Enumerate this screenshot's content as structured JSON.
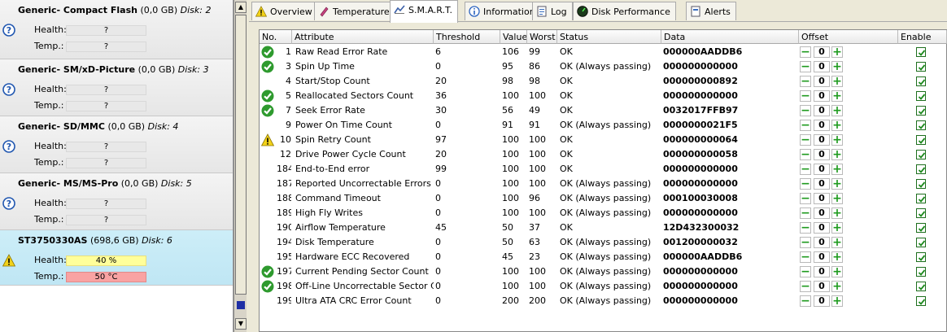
{
  "disks": [
    {
      "name": "Generic- Compact Flash",
      "size": "(0,0 GB)",
      "disk": "Disk: 2",
      "health_label": "Health:",
      "health": "?",
      "temp_label": "Temp.:",
      "temp": "?",
      "status": "unknown"
    },
    {
      "name": "Generic- SM/xD-Picture",
      "size": "(0,0 GB)",
      "disk": "Disk: 3",
      "health_label": "Health:",
      "health": "?",
      "temp_label": "Temp.:",
      "temp": "?",
      "status": "unknown"
    },
    {
      "name": "Generic- SD/MMC",
      "size": "(0,0 GB)",
      "disk": "Disk: 4",
      "health_label": "Health:",
      "health": "?",
      "temp_label": "Temp.:",
      "temp": "?",
      "status": "unknown"
    },
    {
      "name": "Generic- MS/MS-Pro",
      "size": "(0,0 GB)",
      "disk": "Disk: 5",
      "health_label": "Health:",
      "health": "?",
      "temp_label": "Temp.:",
      "temp": "?",
      "status": "unknown"
    },
    {
      "name": "ST3750330AS",
      "size": "(698,6 GB)",
      "disk": "Disk: 6",
      "health_label": "Health:",
      "health": "40 %",
      "temp_label": "Temp.:",
      "temp": "50 °C",
      "status": "warning"
    }
  ],
  "tabs": [
    {
      "label": "Overview",
      "icon": "warning-icon"
    },
    {
      "label": "Temperature",
      "icon": "thermometer-icon"
    },
    {
      "label": "S.M.A.R.T.",
      "icon": "smart-icon",
      "active": true
    },
    {
      "label": "Information",
      "icon": "info-icon"
    },
    {
      "label": "Log",
      "icon": "log-icon"
    },
    {
      "label": "Disk Performance",
      "icon": "performance-icon"
    },
    {
      "label": "Alerts",
      "icon": "alerts-icon"
    }
  ],
  "columns": [
    "No.",
    "Attribute",
    "Threshold",
    "Value",
    "Worst",
    "Status",
    "Data",
    "Offset",
    "Enable"
  ],
  "rows": [
    {
      "status_icon": "ok",
      "no": "1",
      "attr": "Raw Read Error Rate",
      "thr": "6",
      "val": "106",
      "worst": "99",
      "status": "OK",
      "data": "000000AADDB6",
      "offset": "0"
    },
    {
      "status_icon": "ok",
      "no": "3",
      "attr": "Spin Up Time",
      "thr": "0",
      "val": "95",
      "worst": "86",
      "status": "OK (Always passing)",
      "data": "000000000000",
      "offset": "0"
    },
    {
      "status_icon": "",
      "no": "4",
      "attr": "Start/Stop Count",
      "thr": "20",
      "val": "98",
      "worst": "98",
      "status": "OK",
      "data": "000000000892",
      "offset": "0"
    },
    {
      "status_icon": "ok",
      "no": "5",
      "attr": "Reallocated Sectors Count",
      "thr": "36",
      "val": "100",
      "worst": "100",
      "status": "OK",
      "data": "000000000000",
      "offset": "0"
    },
    {
      "status_icon": "ok",
      "no": "7",
      "attr": "Seek Error Rate",
      "thr": "30",
      "val": "56",
      "worst": "49",
      "status": "OK",
      "data": "0032017FFB97",
      "offset": "0"
    },
    {
      "status_icon": "",
      "no": "9",
      "attr": "Power On Time Count",
      "thr": "0",
      "val": "91",
      "worst": "91",
      "status": "OK (Always passing)",
      "data": "0000000021F5",
      "offset": "0"
    },
    {
      "status_icon": "warn",
      "no": "10",
      "attr": "Spin Retry Count",
      "thr": "97",
      "val": "100",
      "worst": "100",
      "status": "OK",
      "data": "000000000064",
      "offset": "0"
    },
    {
      "status_icon": "",
      "no": "12",
      "attr": "Drive Power Cycle Count",
      "thr": "20",
      "val": "100",
      "worst": "100",
      "status": "OK",
      "data": "000000000058",
      "offset": "0"
    },
    {
      "status_icon": "",
      "no": "184",
      "attr": "End-to-End error",
      "thr": "99",
      "val": "100",
      "worst": "100",
      "status": "OK",
      "data": "000000000000",
      "offset": "0"
    },
    {
      "status_icon": "",
      "no": "187",
      "attr": "Reported Uncorrectable Errors",
      "thr": "0",
      "val": "100",
      "worst": "100",
      "status": "OK (Always passing)",
      "data": "000000000000",
      "offset": "0"
    },
    {
      "status_icon": "",
      "no": "188",
      "attr": "Command Timeout",
      "thr": "0",
      "val": "100",
      "worst": "96",
      "status": "OK (Always passing)",
      "data": "000100030008",
      "offset": "0"
    },
    {
      "status_icon": "",
      "no": "189",
      "attr": "High Fly Writes",
      "thr": "0",
      "val": "100",
      "worst": "100",
      "status": "OK (Always passing)",
      "data": "000000000000",
      "offset": "0"
    },
    {
      "status_icon": "",
      "no": "190",
      "attr": "Airflow Temperature",
      "thr": "45",
      "val": "50",
      "worst": "37",
      "status": "OK",
      "data": "12D432300032",
      "offset": "0"
    },
    {
      "status_icon": "",
      "no": "194",
      "attr": "Disk Temperature",
      "thr": "0",
      "val": "50",
      "worst": "63",
      "status": "OK (Always passing)",
      "data": "001200000032",
      "offset": "0"
    },
    {
      "status_icon": "",
      "no": "195",
      "attr": "Hardware ECC Recovered",
      "thr": "0",
      "val": "45",
      "worst": "23",
      "status": "OK (Always passing)",
      "data": "000000AADDB6",
      "offset": "0"
    },
    {
      "status_icon": "ok",
      "no": "197",
      "attr": "Current Pending Sector Count",
      "thr": "0",
      "val": "100",
      "worst": "100",
      "status": "OK (Always passing)",
      "data": "000000000000",
      "offset": "0"
    },
    {
      "status_icon": "ok",
      "no": "198",
      "attr": "Off-Line Uncorrectable Sector Count",
      "thr": "0",
      "val": "100",
      "worst": "100",
      "status": "OK (Always passing)",
      "data": "000000000000",
      "offset": "0"
    },
    {
      "status_icon": "",
      "no": "199",
      "attr": "Ultra ATA CRC Error Count",
      "thr": "0",
      "val": "200",
      "worst": "200",
      "status": "OK (Always passing)",
      "data": "000000000000",
      "offset": "0"
    }
  ],
  "offset_buttons": {
    "minus": "−",
    "plus": "+"
  },
  "colors": {
    "ok": "#2e9a2e",
    "warning": "#f2d21a",
    "unknown": "#1f56b0",
    "selected_bg": "#c6eaf6"
  }
}
